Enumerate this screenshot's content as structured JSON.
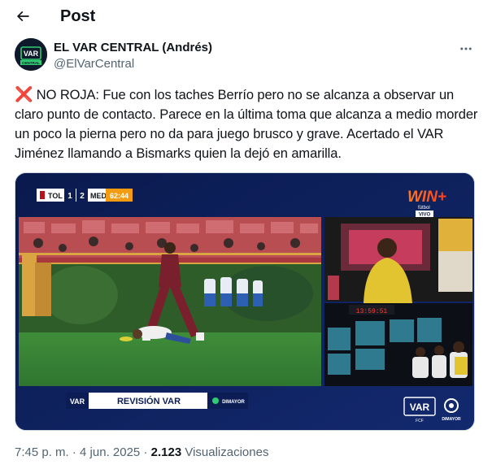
{
  "header": {
    "title": "Post"
  },
  "author": {
    "display_name": "EL VAR CENTRAL (Andrés)",
    "handle": "@ElVarCentral",
    "avatar_text_top": "VAR",
    "avatar_text_bottom": "CENTRAL"
  },
  "post": {
    "text": "NO ROJA: Fue con los taches Berrío pero no se alcanza a observar un claro punto de contacto. Parece en la última toma que alcanza a medio morder un poco la pierna pero no da para juego brusco y grave. Acertado el VAR Jiménez llamando a Bismarks quien la dejó en amarilla.",
    "emoji": "❌"
  },
  "media": {
    "scoreboard": {
      "home": "TOL",
      "home_score": "1",
      "away_score": "2",
      "away": "MED",
      "clock": "62:44"
    },
    "broadcaster": "WIN+",
    "broadcaster_sub": "fútbol",
    "live_tag": "VIVO",
    "banner_logo": "VAR",
    "banner_text": "REVISIÓN VAR",
    "banner_partner": "DIMAYOR",
    "corner_var_logo": "VAR",
    "corner_var_sub": "FCF",
    "corner_partner": "DIMAYOR",
    "var_clock": "13:59:51"
  },
  "meta": {
    "time": "7:45 p. m.",
    "separator": "·",
    "date": "4 jun. 2025",
    "views_count": "2.123",
    "views_label": "Visualizaciones"
  },
  "colors": {
    "text_primary": "#0f1419",
    "text_secondary": "#536471",
    "x_mark": "#dd2e44",
    "scoreboard_clock": "#f39c12",
    "broadcast_blue": "#0c1d56"
  },
  "icons": {
    "back": "arrow-left-icon",
    "more": "more-horizontal-icon"
  }
}
